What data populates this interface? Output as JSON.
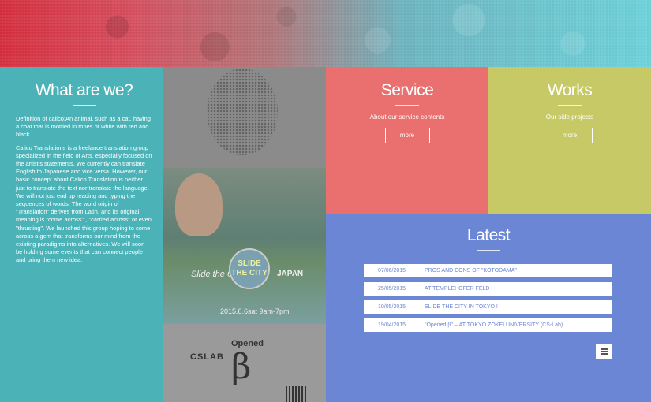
{
  "about": {
    "title": "What are we?",
    "para1": "Definition of calico:An animal, such as a cat, having a coat that is mottled in tones of white with red and black.",
    "para2": "Calico Translations is a freelance translation group specialized in the field of Arts, especially focused on the artist's statements. We currently can translate English to Japanese and vice versa. However, our basic concept about Calico Translation is neither just to translate the text nor translate the language. We will not just end up reading and typing the sequences of words. The word origin of \"Translation\" derives from Latin, and its original meaning is \"come across\" , \"carried across\" or even \"thrusting\". We launched this group hoping to come across a gem that transforms our mind from the existing paradigms into alternatives. We will soon be holding some events that can connect people and bring them new idea."
  },
  "poster": {
    "left_text": "Slide the City",
    "logo_text": "SLIDE THE CITY",
    "right_text": "JAPAN",
    "date_text": "2015.6.6sat 9am-7pm",
    "cslab": "CSLAB",
    "opened": "Opened",
    "beta": "β"
  },
  "service": {
    "title": "Service",
    "subtitle": "About our service contents",
    "button": "more"
  },
  "works": {
    "title": "Works",
    "subtitle": "Our side projects",
    "button": "more"
  },
  "latest": {
    "title": "Latest",
    "items": [
      {
        "date": "07/06/2015",
        "title": "PROS AND CONS OF \"KOTODAMA\""
      },
      {
        "date": "25/05/2015",
        "title": "AT TEMPLEHOFER FELD"
      },
      {
        "date": "10/05/2015",
        "title": "SLIDE THE CITY IN TOKYO !"
      },
      {
        "date": "19/04/2015",
        "title": "\"Opened β\" – AT TOKYO ZOKEI UNIVERSITY (CS-Lab)"
      }
    ],
    "menu_icon": "hamburger-menu-icon"
  },
  "colors": {
    "about_bg": "#4bb3b8",
    "service_bg": "#e9706e",
    "works_bg": "#c6c965",
    "latest_bg": "#6b86d4"
  }
}
